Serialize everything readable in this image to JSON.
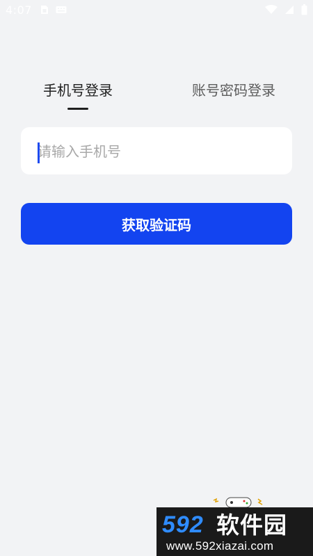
{
  "status_bar": {
    "time": "4:07",
    "left_icons": [
      "sim-card-icon",
      "keyboard-icon"
    ],
    "right_icons": [
      "wifi-icon",
      "signal-icon",
      "battery-icon"
    ]
  },
  "tabs": [
    {
      "label": "手机号登录",
      "active": true
    },
    {
      "label": "账号密码登录",
      "active": false
    }
  ],
  "phone_input": {
    "placeholder": "请输入手机号",
    "value": ""
  },
  "get_code_button": {
    "label": "获取验证码"
  },
  "watermark": {
    "brand_number": "592",
    "brand_text": "软件园",
    "url": "www.592xiazai.com"
  },
  "colors": {
    "background": "#f2f3f5",
    "accent": "#1344f0",
    "card": "#ffffff",
    "active_tab_text": "#1f1f1f",
    "inactive_tab_text": "#5c5c5c",
    "placeholder": "#a8a8a8"
  }
}
